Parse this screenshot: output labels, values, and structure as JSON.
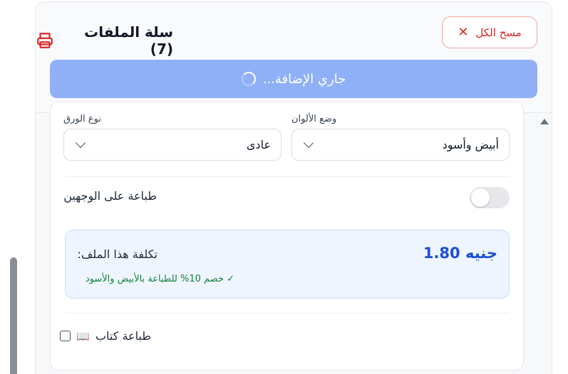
{
  "cart": {
    "title": "سلة الملفات (7)",
    "clear_all_label": "مسح الكل",
    "adding_status": "...جاري الإضافة"
  },
  "file_options": {
    "paper_type_label": "نوع الورق",
    "paper_type_value": "عادى",
    "color_mode_label": "وضع الألوان",
    "color_mode_value": "أبيض وأسود",
    "duplex_label": "طباعة على الوجهين",
    "duplex_enabled": false,
    "cost_label": ":تكلفة هذا الملف",
    "cost_value": "جنيه 1.80",
    "discount_note": "خصم 10% للطباعة بالأبيض والأسود ✓",
    "book_print_label": "طباعة كتاب",
    "book_print_checked": false
  },
  "icons": {
    "printer": "printer-icon",
    "close": "close-icon",
    "spinner": "spinner-icon",
    "chevron": "chevron-down-icon",
    "book": "open-book-icon"
  },
  "colors": {
    "danger": "#dc2626",
    "primary_disabled": "#8fb0f6",
    "price": "#1d4ed8",
    "success": "#15803d",
    "cost_bg": "#eef5ff"
  }
}
